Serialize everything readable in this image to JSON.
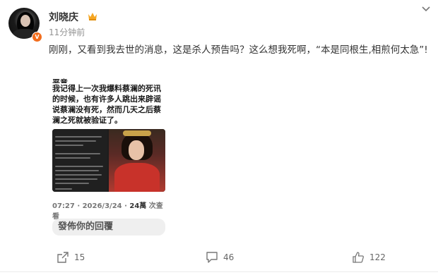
{
  "author": {
    "name": "刘晓庆",
    "verified_badge": "V",
    "badge_icon": "crown-icon"
  },
  "post": {
    "time": "11分钟前",
    "text": "刚刚，又看到我去世的消息，这是杀人预告吗？这么想我死啊，“本是同根生,相煎何太急”!"
  },
  "embedded_card": {
    "top_clip": "恶意。",
    "body": "我记得上一次我爆料蔡澜的死讯的时候，也有许多人跳出来辟谣说蔡澜没有死，然而几天之后蔡澜之死就被验证了。",
    "meta_date": "07:27 · 2026/3/24 · ",
    "meta_views_num": "24萬",
    "meta_views_label": " 次查看",
    "reply_placeholder": "發佈你的回覆"
  },
  "actions": {
    "share_count": "15",
    "comment_count": "46",
    "like_count": "122"
  },
  "colors": {
    "accent_orange": "#f26d1d",
    "text": "#333333",
    "muted": "#939393"
  }
}
